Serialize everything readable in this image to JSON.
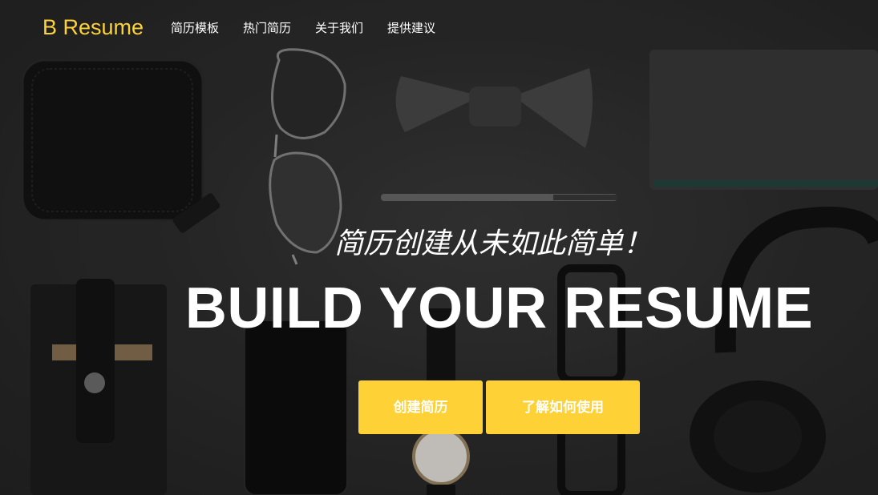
{
  "navbar": {
    "brand": "B Resume",
    "items": [
      {
        "label": "简历模板"
      },
      {
        "label": "热门简历"
      },
      {
        "label": "关于我们"
      },
      {
        "label": "提供建议"
      }
    ]
  },
  "hero": {
    "subtitle": "简历创建从未如此简单！",
    "headline": "BUILD YOUR RESUME",
    "buttons": {
      "create_label": "创建简历",
      "learn_label": "了解如何使用"
    },
    "background_description_icons": [
      "wallet-image",
      "sunglasses-image",
      "bow-tie-image",
      "notebook-image",
      "pen-image",
      "headphones-image",
      "card-holder-image",
      "phone-image",
      "watch-image",
      "glasses-image"
    ]
  },
  "colors": {
    "accent": "#fed136",
    "background": "#2b2b2b",
    "text": "#ffffff"
  }
}
